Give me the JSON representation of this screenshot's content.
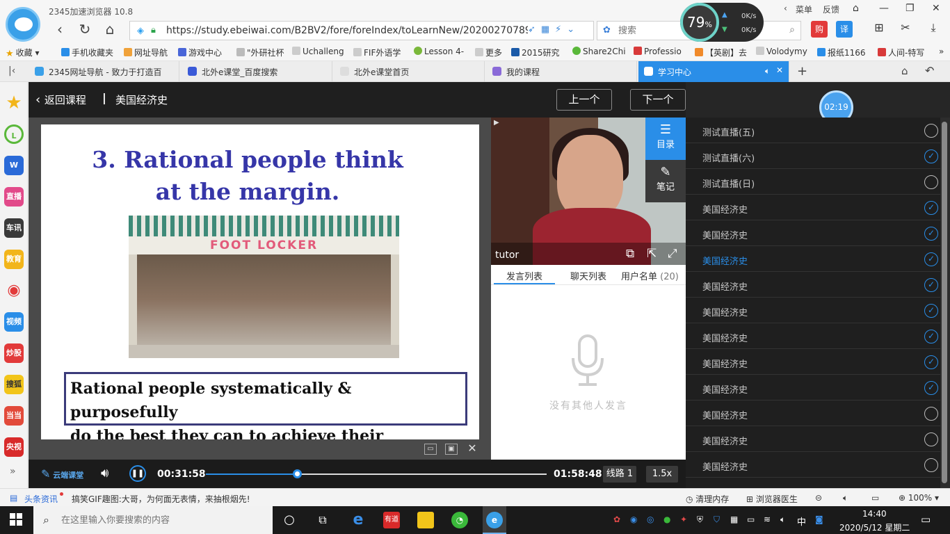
{
  "browser": {
    "title": "2345加速浏览器 10.8",
    "url": "https://study.ebeiwai.com/B2BV2/fore/foreIndex/toLearnNew/20200270789/",
    "search_placeholder": "搜索",
    "speed_percent": "79",
    "speed_unit": "%",
    "upload": "0K/s",
    "download": "0K/s",
    "menu_label": "菜单",
    "feedback_label": "反馈"
  },
  "bookmarks": [
    "收藏",
    "手机收藏夹",
    "网址导航",
    "游戏中心",
    "\"外研社杯",
    "Uchalleng",
    "FIF外语学",
    "Lesson 4-",
    "更多",
    "2015研究",
    "Share2Chi",
    "Professio",
    "【英剧】去",
    "Volodymy",
    "报纸1166",
    "人间-特写"
  ],
  "tabs": [
    {
      "label": "2345网址导航 - 致力于打造百"
    },
    {
      "label": "北外e课堂_百度搜索"
    },
    {
      "label": "北外e课堂首页"
    },
    {
      "label": "我的课程"
    },
    {
      "label": "学习中心"
    }
  ],
  "sidebar": [
    "直播",
    "车讯",
    "教育",
    "视频",
    "炒股",
    "搜狐",
    "当当",
    "央视"
  ],
  "course": {
    "back_label": "返回课程",
    "separator": "|",
    "title": "美国经济史",
    "prev_label": "上一个",
    "next_label": "下一个"
  },
  "slide": {
    "title_line1": "3. Rational people think",
    "title_line2": "at the margin.",
    "photo_sign": "FOOT LOCKER",
    "quote_line1": "Rational people systematically & purposefully",
    "quote_line2": "do the best they can to achieve their objectives."
  },
  "video": {
    "label": "tutor",
    "menu_label": "目录",
    "note_label": "笔记"
  },
  "chat": {
    "tab1": "发言列表",
    "tab2": "聊天列表",
    "tab3": "用户名单",
    "user_count": "(20)",
    "empty_text": "没有其他人发言"
  },
  "timer": "02:19",
  "lessons": [
    {
      "title": "测试直播(五)",
      "done": false,
      "current": false
    },
    {
      "title": "测试直播(六)",
      "done": true,
      "current": false
    },
    {
      "title": "测试直播(日)",
      "done": false,
      "current": false
    },
    {
      "title": "美国经济史",
      "done": true,
      "current": false
    },
    {
      "title": "美国经济史",
      "done": true,
      "current": false
    },
    {
      "title": "美国经济史",
      "done": true,
      "current": true
    },
    {
      "title": "美国经济史",
      "done": true,
      "current": false
    },
    {
      "title": "美国经济史",
      "done": true,
      "current": false
    },
    {
      "title": "美国经济史",
      "done": true,
      "current": false
    },
    {
      "title": "美国经济史",
      "done": true,
      "current": false
    },
    {
      "title": "美国经济史",
      "done": true,
      "current": false
    },
    {
      "title": "美国经济史",
      "done": false,
      "current": false
    },
    {
      "title": "美国经济史",
      "done": false,
      "current": false
    },
    {
      "title": "美国经济史",
      "done": false,
      "current": false
    }
  ],
  "player": {
    "brand": "云端课堂",
    "current_time": "00:31:58",
    "duration": "01:58:48",
    "progress_fraction": 0.27,
    "line_label": "线路 1",
    "speed_label": "1.5x"
  },
  "statusbar": {
    "news_label": "头条资讯",
    "news_text": "搞笑GIF趣图:大哥，为何面无表情，来抽根烟先!",
    "clean_label": "清理内存",
    "doctor_label": "浏览器医生",
    "zoom": "100%"
  },
  "taskbar": {
    "search_placeholder": "在这里输入你要搜索的内容",
    "ime": "中",
    "time": "14:40",
    "date": "2020/5/12 星期二"
  },
  "colors": {
    "accent": "#2a8ee8",
    "slide_title": "#3636a8",
    "dark_bg": "#262626"
  }
}
